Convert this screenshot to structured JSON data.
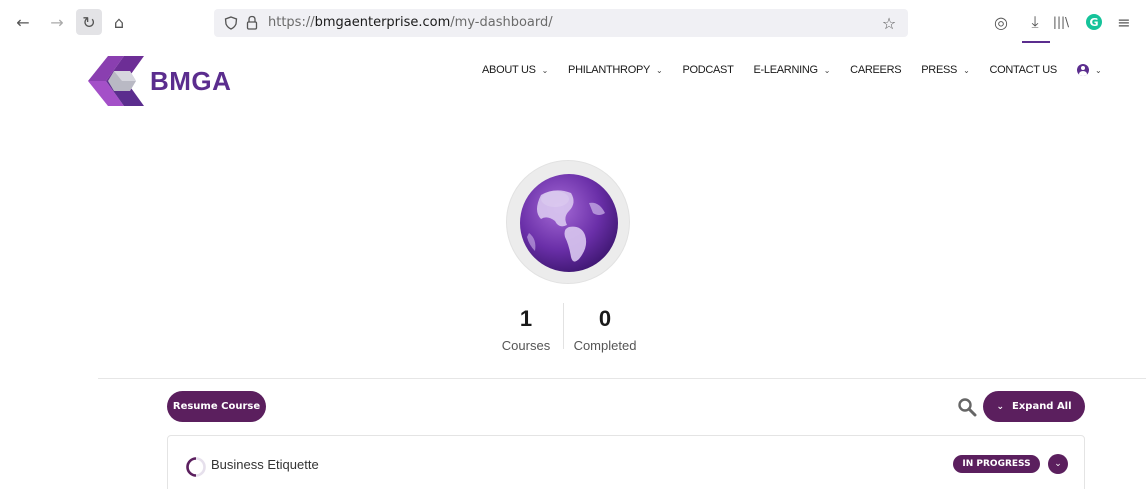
{
  "browser": {
    "back_icon": "←",
    "forward_icon": "→",
    "reload_icon": "↻",
    "home_icon": "⌂",
    "url_scheme": "https://",
    "url_host": "bmgaenterprise.com",
    "url_path": "/my-dashboard/",
    "star_icon": "☆",
    "pocket_icon": "◎",
    "download_icon": "⤓",
    "library_icon": "|||\\",
    "grammarly_letter": "G",
    "menu_icon": "≡"
  },
  "site": {
    "logo_text": "BMGA",
    "brand_color": "#5b2d8e",
    "accent_color": "#5b1f5e"
  },
  "nav": {
    "items": [
      {
        "label": "ABOUT US",
        "dropdown": true
      },
      {
        "label": "PHILANTHROPY",
        "dropdown": true
      },
      {
        "label": "PODCAST",
        "dropdown": false
      },
      {
        "label": "E-LEARNING",
        "dropdown": true
      },
      {
        "label": "CAREERS",
        "dropdown": false
      },
      {
        "label": "PRESS",
        "dropdown": true
      },
      {
        "label": "CONTACT US",
        "dropdown": false
      }
    ],
    "chevron": "⌄"
  },
  "stats": {
    "courses_value": "1",
    "courses_label": "Courses",
    "completed_value": "0",
    "completed_label": "Completed"
  },
  "actions": {
    "resume_label": "Resume Course",
    "expand_label": "Expand All",
    "expand_icon": "⌄"
  },
  "courses": [
    {
      "title": "Business Etiquette",
      "status": "IN PROGRESS",
      "toggle_icon": "⌄"
    }
  ]
}
